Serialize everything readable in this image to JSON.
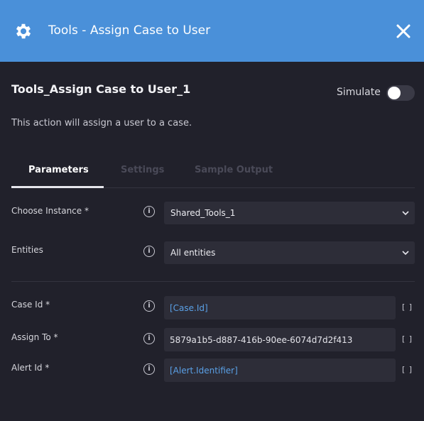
{
  "header": {
    "icon": "gear-icon",
    "title": "Tools - Assign Case to User",
    "close_icon": "close-icon",
    "bg_color": "#4a90d9"
  },
  "action": {
    "name": "Tools_Assign Case to User_1",
    "simulate_label": "Simulate",
    "simulate_on": false,
    "description": "This action will assign a user to a case."
  },
  "tabs": [
    {
      "label": "Parameters",
      "active": true
    },
    {
      "label": "Settings",
      "active": false
    },
    {
      "label": "Sample Output",
      "active": false
    }
  ],
  "params": {
    "instance": {
      "label": "Choose Instance *",
      "value": "Shared_Tools_1"
    },
    "entities": {
      "label": "Entities",
      "value": "All entities"
    },
    "case_id": {
      "label": "Case Id  *",
      "value": "[Case.Id]"
    },
    "assign_to": {
      "label": "Assign To  *",
      "value": "5879a1b5-d887-416b-90ee-6074d7d2f413"
    },
    "alert_id": {
      "label": "Alert Id  *",
      "value": "[Alert.Identifier]"
    },
    "bracket_text": "[ ]",
    "info_glyph": "i"
  }
}
